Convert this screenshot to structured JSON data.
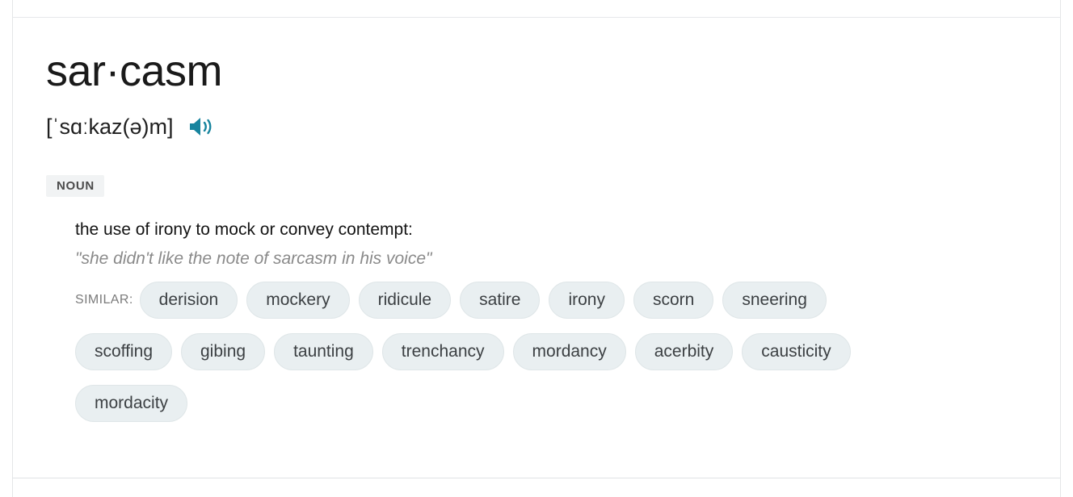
{
  "entry": {
    "headword": "sar·casm",
    "phonetic": "[ˈsɑːkaz(ə)m]",
    "audio_icon": "speaker-icon",
    "audio_color": "#17849e",
    "part_of_speech": "NOUN",
    "definition": "the use of irony to mock or convey contempt:",
    "example": "\"she didn't like the note of sarcasm in his voice\"",
    "similar_label": "SIMILAR:",
    "similar_rows": [
      [
        "derision",
        "mockery",
        "ridicule",
        "satire",
        "irony",
        "scorn",
        "sneering"
      ],
      [
        "scoffing",
        "gibing",
        "taunting",
        "trenchancy",
        "mordancy",
        "acerbity",
        "causticity"
      ],
      [
        "mordacity"
      ]
    ]
  },
  "colors": {
    "chip_background": "#e9eff1",
    "chip_border": "#dfe6e8",
    "badge_background": "#f1f3f4",
    "example_text": "#8a8a8a",
    "card_border": "#e4e6e8"
  }
}
